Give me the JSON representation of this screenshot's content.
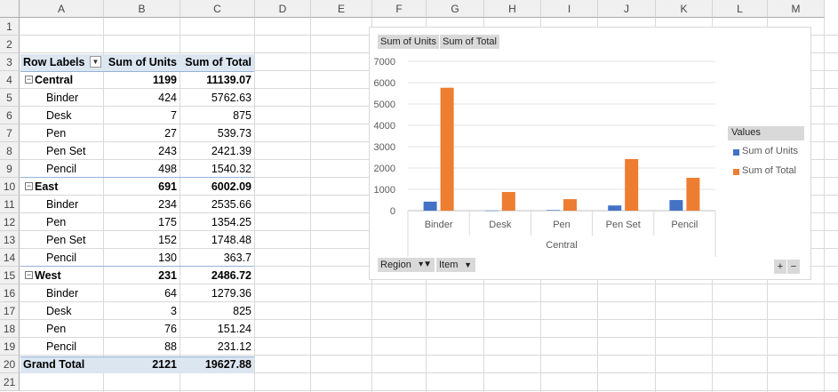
{
  "columns": [
    "A",
    "B",
    "C",
    "D",
    "E",
    "F",
    "G",
    "H",
    "I",
    "J",
    "K",
    "L",
    "M"
  ],
  "rows": [
    "1",
    "2",
    "3",
    "4",
    "5",
    "6",
    "7",
    "8",
    "9",
    "10",
    "11",
    "12",
    "13",
    "14",
    "15",
    "16",
    "17",
    "18",
    "19",
    "20",
    "21"
  ],
  "pivot": {
    "header": {
      "row_labels": "Row Labels",
      "sum_units": "Sum of Units",
      "sum_total": "Sum of Total"
    },
    "regions": [
      {
        "name": "Central",
        "units": "1199",
        "total": "11139.07",
        "items": [
          {
            "name": "Binder",
            "units": "424",
            "total": "5762.63"
          },
          {
            "name": "Desk",
            "units": "7",
            "total": "875"
          },
          {
            "name": "Pen",
            "units": "27",
            "total": "539.73"
          },
          {
            "name": "Pen Set",
            "units": "243",
            "total": "2421.39"
          },
          {
            "name": "Pencil",
            "units": "498",
            "total": "1540.32"
          }
        ]
      },
      {
        "name": "East",
        "units": "691",
        "total": "6002.09",
        "items": [
          {
            "name": "Binder",
            "units": "234",
            "total": "2535.66"
          },
          {
            "name": "Pen",
            "units": "175",
            "total": "1354.25"
          },
          {
            "name": "Pen Set",
            "units": "152",
            "total": "1748.48"
          },
          {
            "name": "Pencil",
            "units": "130",
            "total": "363.7"
          }
        ]
      },
      {
        "name": "West",
        "units": "231",
        "total": "2486.72",
        "items": [
          {
            "name": "Binder",
            "units": "64",
            "total": "1279.36"
          },
          {
            "name": "Desk",
            "units": "3",
            "total": "825"
          },
          {
            "name": "Pen",
            "units": "76",
            "total": "151.24"
          },
          {
            "name": "Pencil",
            "units": "88",
            "total": "231.12"
          }
        ]
      }
    ],
    "grand_total": {
      "label": "Grand Total",
      "units": "2121",
      "total": "19627.88"
    }
  },
  "chart": {
    "field_buttons": {
      "units": "Sum of Units",
      "total": "Sum of Total",
      "region": "Region",
      "item": "Item"
    },
    "legend_title": "Values",
    "zoom_plus": "+",
    "zoom_minus": "−",
    "colors": {
      "units": "#4472c4",
      "total": "#ed7d31"
    }
  },
  "chart_data": {
    "type": "bar",
    "categories": [
      "Binder",
      "Desk",
      "Pen",
      "Pen Set",
      "Pencil"
    ],
    "group_label": "Central",
    "series": [
      {
        "name": "Sum of Units",
        "values": [
          424,
          7,
          27,
          243,
          498
        ]
      },
      {
        "name": "Sum of Total",
        "values": [
          5762.63,
          875,
          539.73,
          2421.39,
          1540.32
        ]
      }
    ],
    "ylim": [
      0,
      7000
    ],
    "yticks": [
      "0",
      "1000",
      "2000",
      "3000",
      "4000",
      "5000",
      "6000",
      "7000"
    ],
    "grid": true,
    "legend_position": "right"
  }
}
